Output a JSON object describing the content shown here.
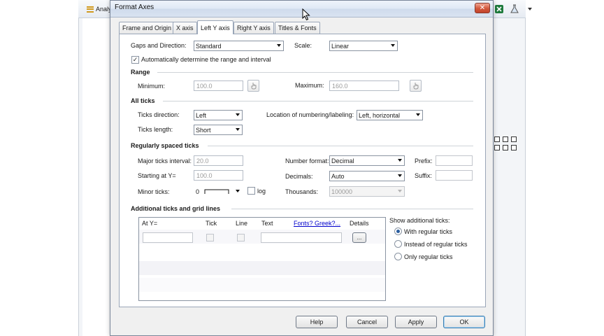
{
  "background_app": {
    "menu_partial": "Analy"
  },
  "dialog": {
    "title": "Format Axes",
    "close_glyph": "✕",
    "tabs": [
      {
        "label": "Frame and Origin",
        "active": false
      },
      {
        "label": "X axis",
        "active": false
      },
      {
        "label": "Left Y axis",
        "active": true
      },
      {
        "label": "Right Y axis",
        "active": false
      },
      {
        "label": "Titles & Fonts",
        "active": false
      }
    ],
    "gaps": {
      "label": "Gaps and Direction:",
      "value": "Standard"
    },
    "scale": {
      "label": "Scale:",
      "value": "Linear"
    },
    "auto_range": {
      "label": "Automatically determine the range and interval",
      "checked": true
    },
    "range": {
      "heading": "Range",
      "minimum_label": "Minimum:",
      "minimum_value": "100.0",
      "maximum_label": "Maximum:",
      "maximum_value": "160.0"
    },
    "all_ticks": {
      "heading": "All ticks",
      "direction_label": "Ticks direction:",
      "direction_value": "Left",
      "location_label": "Location of numbering/labeling:",
      "location_value": "Left, horizontal",
      "length_label": "Ticks length:",
      "length_value": "Short"
    },
    "regular_ticks": {
      "heading": "Regularly spaced ticks",
      "major_label": "Major ticks interval:",
      "major_value": "20.0",
      "start_label": "Starting at Y=",
      "start_value": "100.0",
      "minor_label": "Minor ticks:",
      "minor_value": "0",
      "log_label": "log",
      "number_format_label": "Number format:",
      "number_format_value": "Decimal",
      "decimals_label": "Decimals:",
      "decimals_value": "Auto",
      "thousands_label": "Thousands:",
      "thousands_value": "100000",
      "prefix_label": "Prefix:",
      "prefix_value": "",
      "suffix_label": "Suffix:",
      "suffix_value": ""
    },
    "additional": {
      "heading": "Additional ticks and grid lines",
      "columns": [
        "At Y=",
        "Tick",
        "Line",
        "Text",
        "Fonts? Greek?...",
        "Details"
      ],
      "details_button": "...",
      "show_label": "Show additional ticks:",
      "options": [
        {
          "label": "With regular ticks",
          "selected": true
        },
        {
          "label": "Instead of regular ticks",
          "selected": false
        },
        {
          "label": "Only regular ticks",
          "selected": false
        }
      ]
    },
    "buttons": {
      "help": "Help",
      "cancel": "Cancel",
      "apply": "Apply",
      "ok": "OK"
    }
  }
}
